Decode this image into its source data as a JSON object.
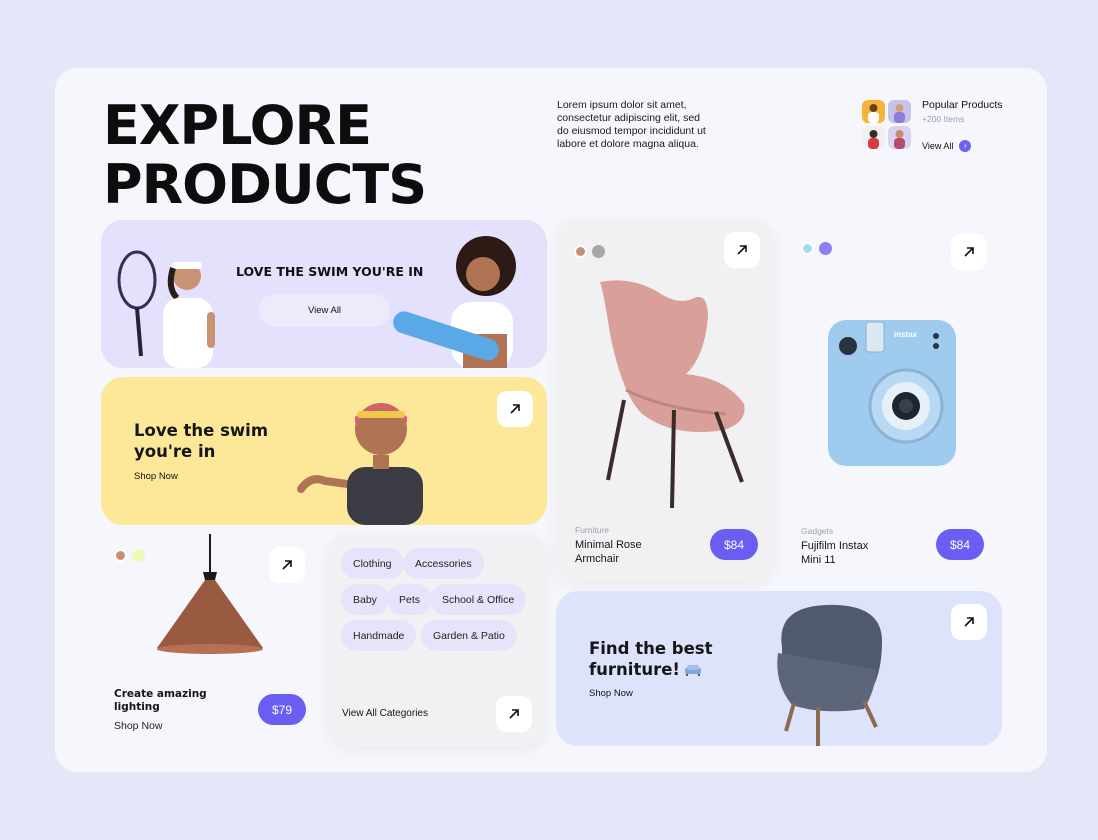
{
  "header": {
    "title_line1": "EXPLORE",
    "title_line2": "PRODUCTS",
    "description": "Lorem ipsum dolor sit amet, consectetur adipiscing elit, sed do eiusmod tempor incididunt ut labore et dolore magna aliqua."
  },
  "popular": {
    "title": "Popular Products",
    "count": "+200 Items",
    "view_all": "View All"
  },
  "banner_swim": {
    "heading": "LOVE THE SWIM YOU'RE IN",
    "button": "View All"
  },
  "promo_yellow": {
    "heading_line1": "Love the swim",
    "heading_line2": "you're in",
    "link": "Shop Now"
  },
  "chair_product": {
    "category": "Furniture",
    "name_line1": "Minimal Rose",
    "name_line2": "Armchair",
    "price": "$84",
    "swatches": [
      "#c98f76",
      "#a7a7a7"
    ]
  },
  "camera_product": {
    "category": "Gadgets",
    "name_line1": "Fujifilm Instax",
    "name_line2": "Mini 11",
    "price": "$84",
    "brand_text": "instax",
    "swatches": [
      "#a8d8f0",
      "#8c7ef3"
    ]
  },
  "lamp_product": {
    "name_line1": "Create amazing",
    "name_line2": "lighting",
    "link": "Shop Now",
    "price": "$79",
    "swatches": [
      "#c98f76",
      "#eafcb8"
    ]
  },
  "categories": {
    "chips": [
      "Clothing",
      "Accessories",
      "Baby",
      "Pets",
      "School & Office",
      "Handmade",
      "Garden & Patio"
    ],
    "view_all": "View All Categories"
  },
  "furniture_banner": {
    "heading_line1": "Find the best",
    "heading_line2": "furniture!",
    "link": "Shop Now"
  },
  "colors": {
    "accent": "#6a5df1",
    "panel": "#f6f7fc",
    "page_bg": "#e3e7f7",
    "lavender": "#e6e4fb",
    "yellow": "#fde99b",
    "blue_banner": "#dde3fb"
  }
}
